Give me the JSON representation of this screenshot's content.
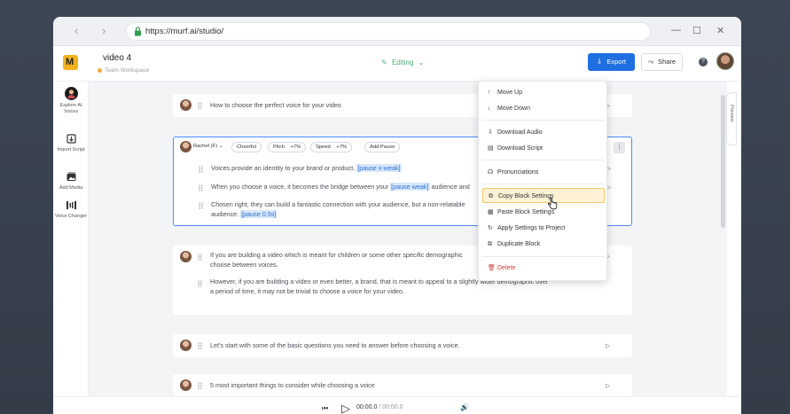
{
  "browser": {
    "url": "https://murf.ai/studio/",
    "back_icon": "‹",
    "forward_icon": "›",
    "minimize_icon": "—",
    "maximize_icon": "☐",
    "close_icon": "✕"
  },
  "header": {
    "logo": "M",
    "project_title": "video 4",
    "workspace": "Team Workspace",
    "mode": "Editing",
    "mode_icon": "✎",
    "mode_chevron": "⌄",
    "export_label": "Export",
    "export_icon": "⇩",
    "share_label": "Share",
    "share_icon": "⤳",
    "help_icon": "?"
  },
  "sidebar": {
    "items": [
      {
        "label": "Explore AI Voices",
        "icon": "voice-avatar-icon"
      },
      {
        "label": "Import Script",
        "icon": "import-icon"
      },
      {
        "label": "Add Media",
        "icon": "media-icon"
      },
      {
        "label": "Voice Changer",
        "icon": "voice-changer-icon"
      }
    ]
  },
  "blocks": [
    {
      "text": "How to choose the perfect voice for your video"
    },
    {
      "voice": "Rachel (F)",
      "style": "Cheerful",
      "pitch": "Pitch",
      "pitch_value": "+7%",
      "speed": "Speed",
      "speed_value": "+7%",
      "add_pause": "Add Pause",
      "more": "⋮",
      "lines": [
        {
          "text": "Voices provide an identity to your brand or product.",
          "pause": "[pause x-weak]"
        },
        {
          "text": "When you choose a voice, it becomes the bridge between your",
          "pause": "[pause weak]",
          "after": "audience and"
        },
        {
          "text": "Chosen right, they can build a fantastic connection with your audience, but a non-relatable",
          "line2": "audience.",
          "pause": "[pause 0.5s]"
        }
      ]
    },
    {
      "lines": [
        {
          "text": "If you are building a video which is meant for children or some other specific demographic",
          "line2": "choose between voices."
        },
        {
          "text": "However, if you are building a video or even better, a brand, that is meant to appeal to a slightly wider demographic over",
          "line2": "a period of time, it may not be trivial to choose a voice for your video."
        }
      ]
    },
    {
      "text": "Let's start with some of the basic questions you need to answer before choosing a voice."
    },
    {
      "text": "5 most important things to consider while choosing a voice"
    }
  ],
  "play_icon": "▷",
  "context_menu": {
    "groups": [
      [
        {
          "label": "Move Up",
          "icon": "↑"
        },
        {
          "label": "Move Down",
          "icon": "↓"
        }
      ],
      [
        {
          "label": "Download Audio",
          "icon": "⇩"
        },
        {
          "label": "Download Script",
          "icon": "▤"
        }
      ],
      [
        {
          "label": "Pronunciations",
          "icon": "☊"
        }
      ],
      [
        {
          "label": "Copy Block Settings",
          "icon": "⧉"
        },
        {
          "label": "Paste Block Settings",
          "icon": "▦"
        },
        {
          "label": "Apply Settings to Project",
          "icon": "↻"
        },
        {
          "label": "Duplicate Block",
          "icon": "⧉"
        }
      ],
      [
        {
          "label": "Delete",
          "icon": "🗑"
        }
      ]
    ]
  },
  "right_rail": {
    "preview_label": "Preview",
    "collapse_icon": "‹"
  },
  "player": {
    "current_time": "00:00.0",
    "separator": " / ",
    "total_time": "00:00.0",
    "skip_back_icon": "⏮",
    "play_icon": "▷",
    "volume_icon": "🔊"
  },
  "colors": {
    "accent": "#1f6fe0",
    "brand": "#f3b21c",
    "editing": "#4caf78",
    "delete": "#d43c3c",
    "highlight": "#fdf2d6"
  }
}
